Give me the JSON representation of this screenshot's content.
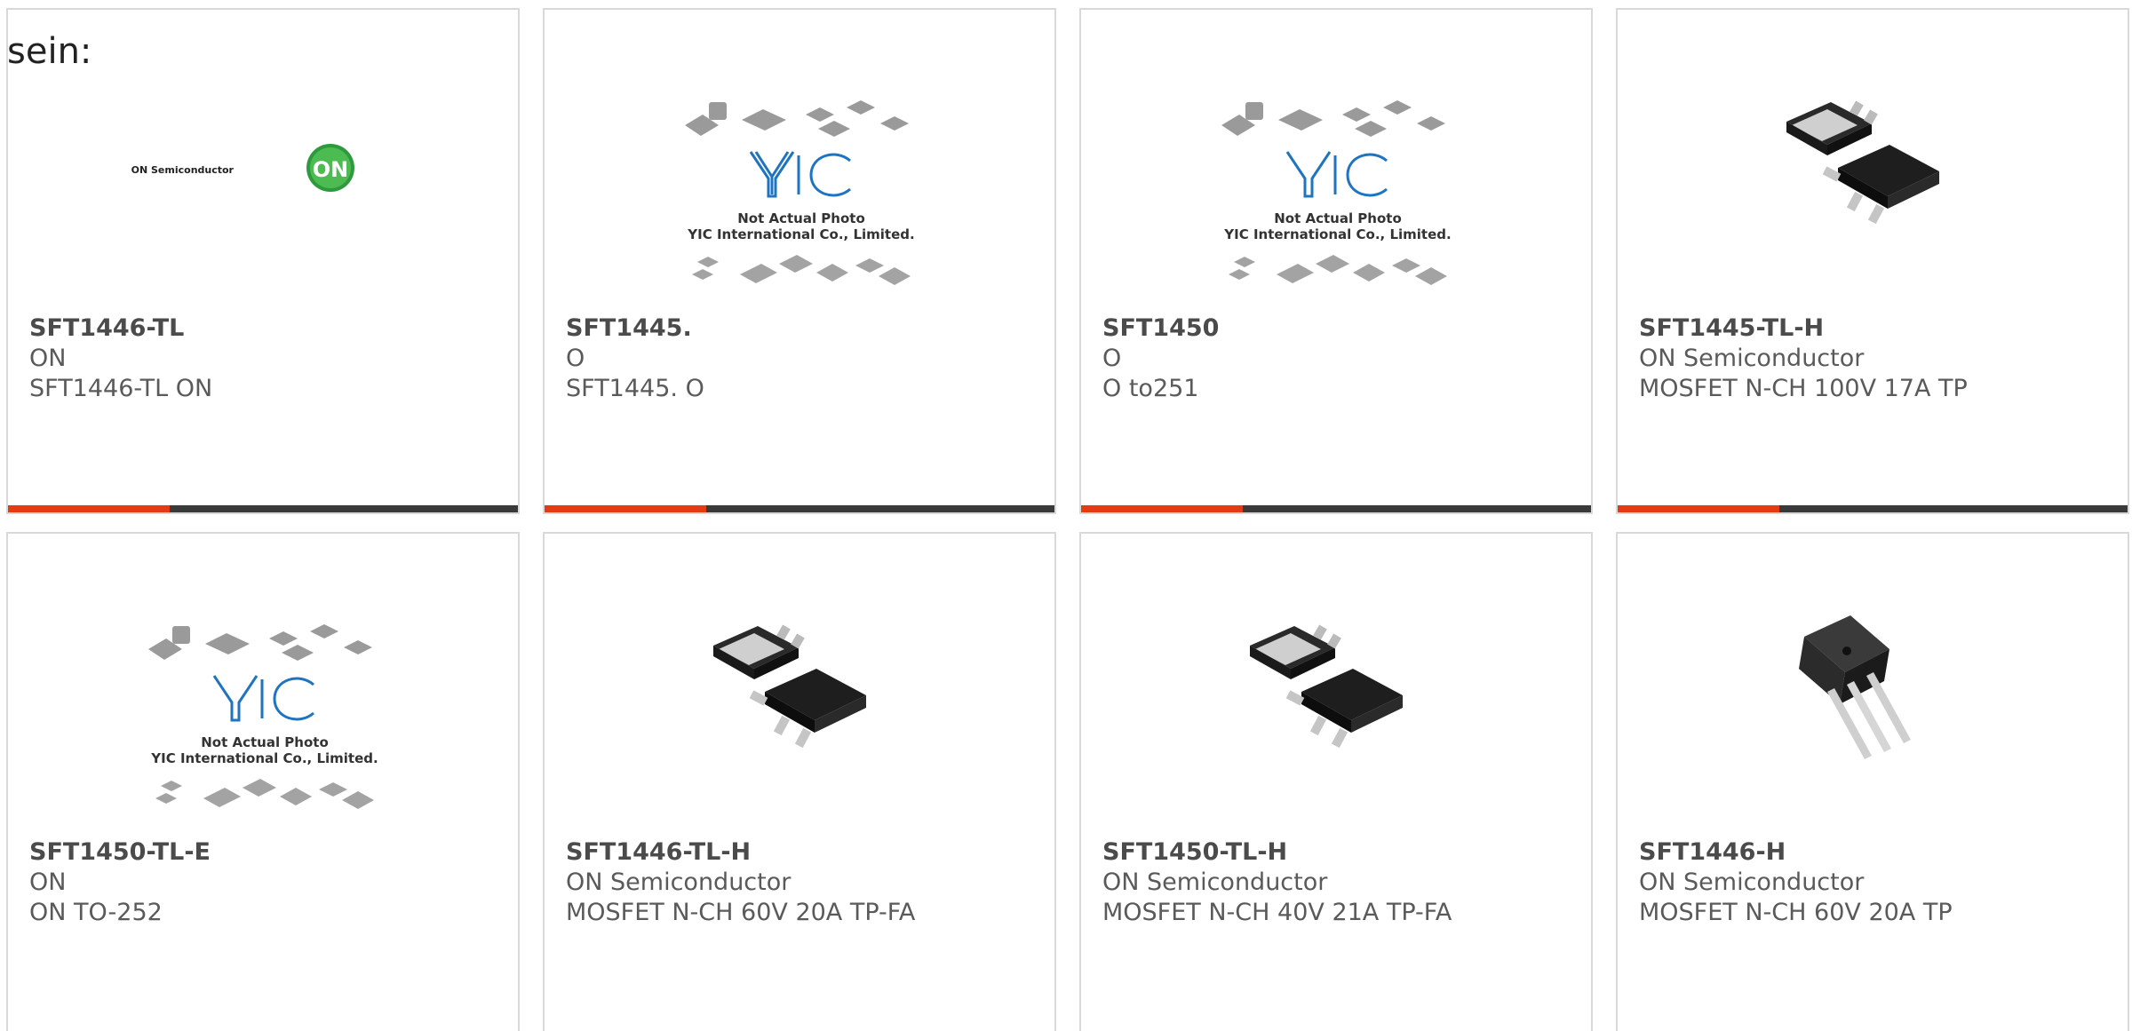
{
  "intro_text": "sein:",
  "accent_color": "#e53b12",
  "bar_color": "#3a3a3a",
  "yic_placeholder": {
    "line1": "Not Actual Photo",
    "line2": "YIC International Co., Limited."
  },
  "on_logo": {
    "wordmark": "ON Semiconductor",
    "badge": "ON"
  },
  "products": [
    {
      "part": "SFT1446-TL",
      "maker": "ON",
      "desc": "SFT1446-TL ON",
      "image": "on-semiconductor-logo"
    },
    {
      "part": "SFT1445.",
      "maker": "O",
      "desc": "SFT1445. O",
      "image": "yic-placeholder"
    },
    {
      "part": "SFT1450",
      "maker": "O",
      "desc": "O to251",
      "image": "yic-placeholder"
    },
    {
      "part": "SFT1445-TL-H",
      "maker": "ON Semiconductor",
      "desc": "MOSFET N-CH 100V 17A TP",
      "image": "dpak-package"
    },
    {
      "part": "SFT1450-TL-E",
      "maker": "ON",
      "desc": "ON TO-252",
      "image": "yic-placeholder"
    },
    {
      "part": "SFT1446-TL-H",
      "maker": "ON Semiconductor",
      "desc": "MOSFET N-CH 60V 20A TP-FA",
      "image": "dpak-package"
    },
    {
      "part": "SFT1450-TL-H",
      "maker": "ON Semiconductor",
      "desc": "MOSFET N-CH 40V 21A TP-FA",
      "image": "dpak-package"
    },
    {
      "part": "SFT1446-H",
      "maker": "ON Semiconductor",
      "desc": "MOSFET N-CH 60V 20A TP",
      "image": "ipak-package"
    }
  ]
}
